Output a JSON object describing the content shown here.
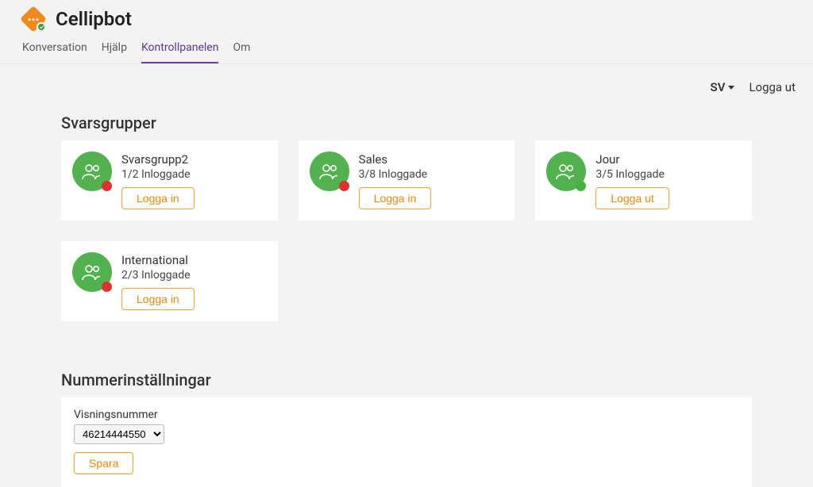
{
  "header": {
    "title": "Cellipbot"
  },
  "nav": {
    "items": [
      "Konversation",
      "Hjälp",
      "Kontrollpanelen",
      "Om"
    ],
    "activeIndex": 2
  },
  "topbar": {
    "lang": "SV",
    "logout": "Logga ut"
  },
  "sections": {
    "groupsTitle": "Svarsgrupper",
    "numbersTitle": "Nummerinställningar"
  },
  "groups": [
    {
      "name": "Svarsgrupp2",
      "sub": "1/2 Inloggade",
      "action": "Logga in",
      "status": "red"
    },
    {
      "name": "Sales",
      "sub": "3/8 Inloggade",
      "action": "Logga in",
      "status": "red"
    },
    {
      "name": "Jour",
      "sub": "3/5 Inloggade",
      "action": "Logga ut",
      "status": "green"
    },
    {
      "name": "International",
      "sub": "2/3 Inloggade",
      "action": "Logga in",
      "status": "red"
    }
  ],
  "numberSettings": {
    "fieldLabel": "Visningsnummer",
    "selected": "46214444550",
    "options": [
      "46214444550"
    ],
    "save": "Spara"
  }
}
